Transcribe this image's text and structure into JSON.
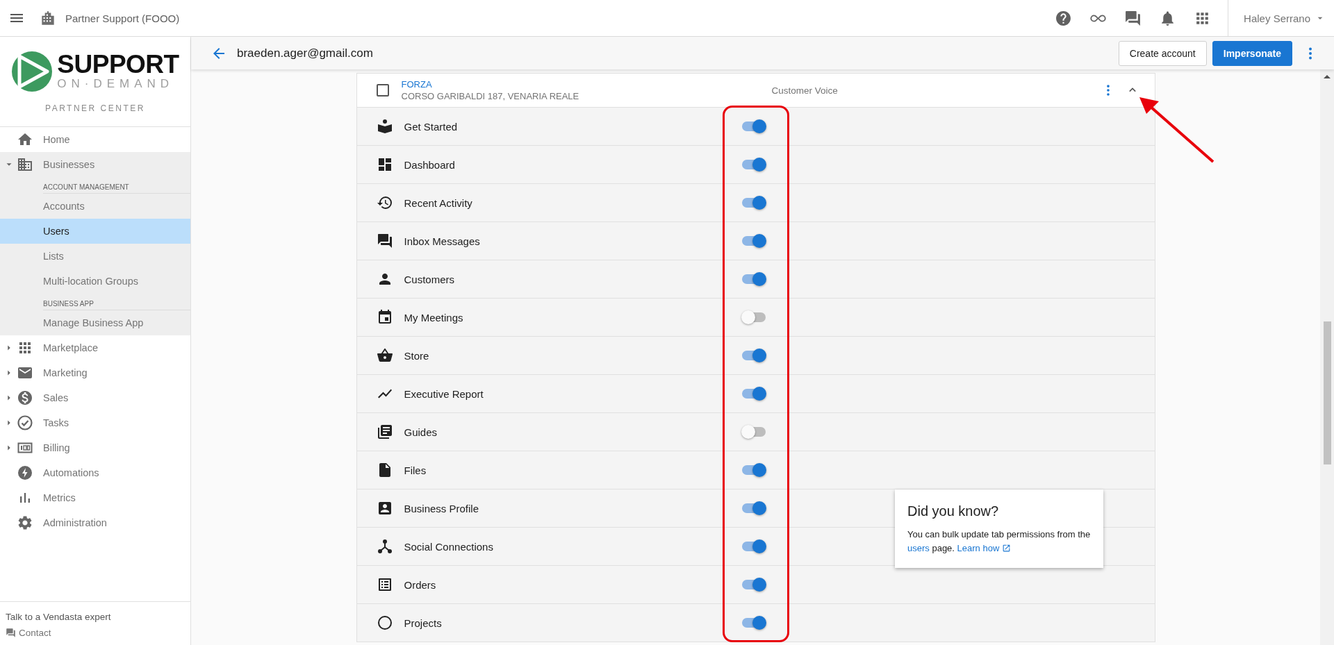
{
  "top_bar": {
    "title": "Partner Support (FOOO)",
    "user": "Haley Serrano"
  },
  "sidebar": {
    "logo": {
      "wordmark": "SUPPORT",
      "tagline": "ON·DEMAND",
      "subtitle": "PARTNER CENTER"
    },
    "items": [
      {
        "label": "Home"
      },
      {
        "label": "Businesses",
        "expanded": true,
        "sections": [
          {
            "heading": "ACCOUNT MANAGEMENT",
            "items": [
              {
                "label": "Accounts",
                "selected": false
              },
              {
                "label": "Users",
                "selected": true
              },
              {
                "label": "Lists",
                "selected": false
              },
              {
                "label": "Multi-location Groups",
                "selected": false
              }
            ]
          },
          {
            "heading": "BUSINESS APP",
            "items": [
              {
                "label": "Manage Business App",
                "selected": false
              }
            ]
          }
        ]
      },
      {
        "label": "Marketplace",
        "expanded": false
      },
      {
        "label": "Marketing",
        "expanded": false
      },
      {
        "label": "Sales",
        "expanded": false
      },
      {
        "label": "Tasks",
        "expanded": false
      },
      {
        "label": "Billing",
        "expanded": false
      },
      {
        "label": "Automations"
      },
      {
        "label": "Metrics"
      },
      {
        "label": "Administration"
      }
    ],
    "footer": {
      "heading": "Talk to a Vendasta expert",
      "contact": "Contact"
    }
  },
  "page_header": {
    "title": "braeden.ager@gmail.com",
    "buttons": [
      {
        "label": "Create account",
        "kind": "outlined"
      },
      {
        "label": "Impersonate",
        "kind": "primary"
      }
    ]
  },
  "account": {
    "checked": false,
    "name": "FORZA",
    "address": "CORSO GARIBALDI 187, VENARIA REALE",
    "product": "Customer Voice",
    "expanded": true,
    "permissions": [
      {
        "label": "Get Started",
        "on": true
      },
      {
        "label": "Dashboard",
        "on": true
      },
      {
        "label": "Recent Activity",
        "on": true
      },
      {
        "label": "Inbox Messages",
        "on": true
      },
      {
        "label": "Customers",
        "on": true
      },
      {
        "label": "My Meetings",
        "on": false
      },
      {
        "label": "Store",
        "on": true
      },
      {
        "label": "Executive Report",
        "on": true
      },
      {
        "label": "Guides",
        "on": false
      },
      {
        "label": "Files",
        "on": true
      },
      {
        "label": "Business Profile",
        "on": true
      },
      {
        "label": "Social Connections",
        "on": true
      },
      {
        "label": "Orders",
        "on": true
      },
      {
        "label": "Projects",
        "on": true
      }
    ]
  },
  "tip": {
    "title": "Did you know?",
    "text_before": "You can bulk update tab permissions from the",
    "link": "users",
    "text_after": "page.",
    "learn_link": "Learn how"
  }
}
